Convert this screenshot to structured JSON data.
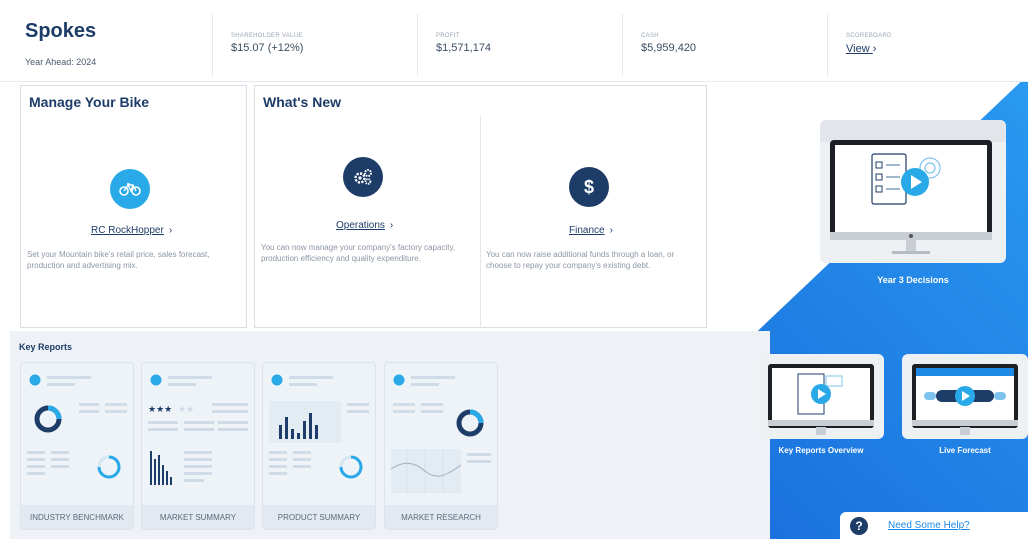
{
  "app": {
    "name": "Spokes",
    "year_ahead": "Year Ahead: 2024"
  },
  "header": {
    "stats": [
      {
        "label": "SHAREHOLDER VALUE",
        "value": "$15.07 (+12%)"
      },
      {
        "label": "PROFIT",
        "value": "$1,571,174"
      },
      {
        "label": "CASH",
        "value": "$5,959,420"
      }
    ],
    "scoreboard": {
      "label": "SCOREBOARD",
      "link": "View"
    }
  },
  "manage_bike": {
    "title": "Manage Your Bike",
    "link": "RC RockHopper",
    "description": "Set your Mountain bike's retail price, sales forecast, production and advertising mix."
  },
  "whats_new": {
    "title": "What's New",
    "items": [
      {
        "link": "Operations",
        "description": "You can now manage your company's factory capacity, production efficiency and quality expenditure."
      },
      {
        "link": "Finance",
        "description": "You can now raise additional funds through a loan, or choose to repay your company's existing debt."
      }
    ]
  },
  "key_reports": {
    "title": "Key Reports",
    "items": [
      {
        "label": "INDUSTRY BENCHMARK"
      },
      {
        "label": "MARKET SUMMARY"
      },
      {
        "label": "PRODUCT SUMMARY"
      },
      {
        "label": "MARKET RESEARCH"
      }
    ]
  },
  "videos": [
    {
      "label": "Year 3 Decisions"
    },
    {
      "label": "Key Reports Overview"
    },
    {
      "label": "Live Forecast"
    }
  ],
  "help": {
    "label": "Need Some Help?"
  },
  "colors": {
    "brand_navy": "#1d3c68",
    "accent_blue": "#1e88e5",
    "cyan": "#29a9e8"
  }
}
